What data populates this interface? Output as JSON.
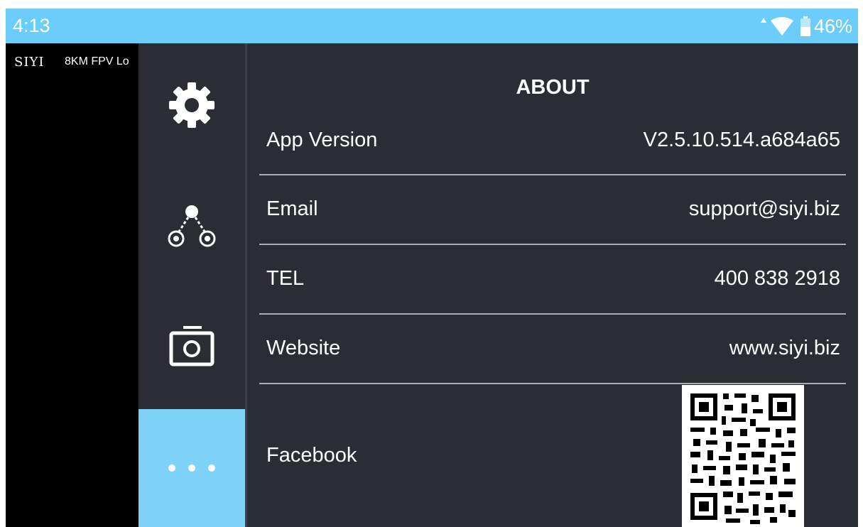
{
  "status_bar": {
    "time": "4:13",
    "battery_text": "46%",
    "icons": [
      "data-arrow-icon",
      "wifi-icon",
      "battery-icon"
    ]
  },
  "video": {
    "brand": "SIYI",
    "text": "8KM FPV Lo"
  },
  "sidebar": {
    "items": [
      {
        "icon": "gear-icon",
        "active": false
      },
      {
        "icon": "link-nodes-icon",
        "active": false
      },
      {
        "icon": "camera-icon",
        "active": false
      },
      {
        "icon": "more-dots-icon",
        "active": true
      }
    ]
  },
  "about": {
    "title": "ABOUT",
    "rows": [
      {
        "label": "App Version",
        "value": "V2.5.10.514.a684a65"
      },
      {
        "label": "Email",
        "value": "support@siyi.biz"
      },
      {
        "label": "TEL",
        "value": "400 838 2918"
      },
      {
        "label": "Website",
        "value": "www.siyi.biz"
      },
      {
        "label": "Facebook",
        "value": ""
      }
    ],
    "facebook_qr": "qr-code-image"
  },
  "colors": {
    "status_bar": "#6ccdfa",
    "panel_bg": "#2a2d34",
    "active_tab": "#7ed2f8",
    "divider": "#a9acb2"
  }
}
